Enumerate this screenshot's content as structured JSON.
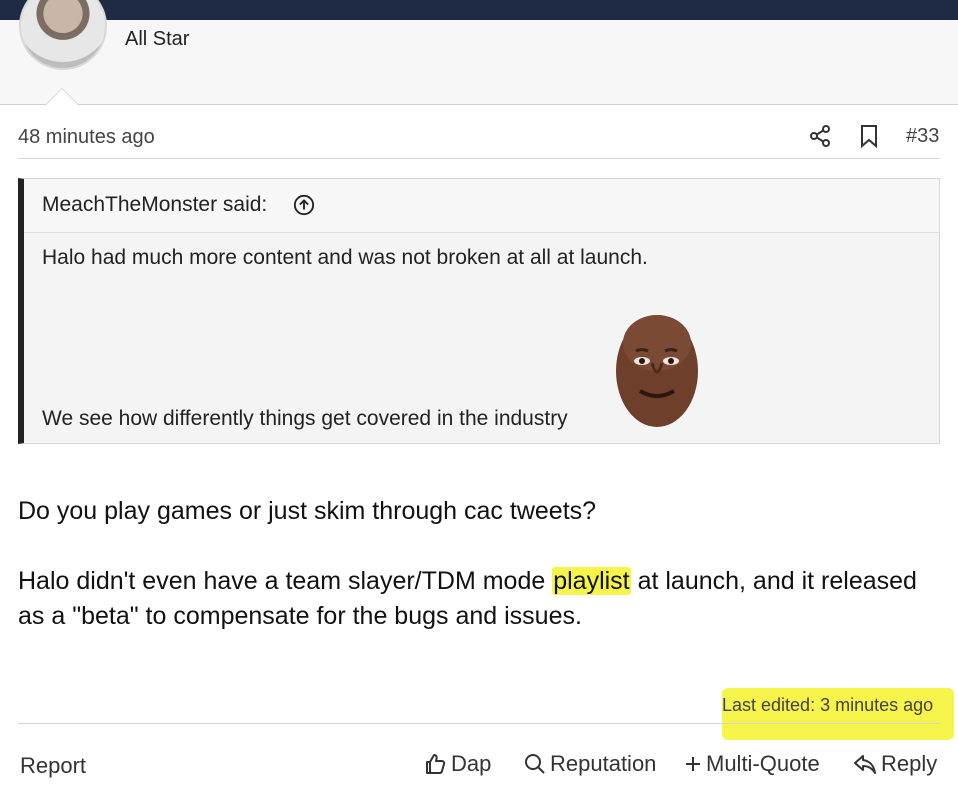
{
  "author": {
    "rank": "All Star"
  },
  "post_meta": {
    "timestamp": "48 minutes ago",
    "post_number": "#33",
    "icons": [
      "share-icon",
      "bookmark-icon"
    ]
  },
  "quote": {
    "author": "MeachTheMonster said:",
    "line1": "Halo had much more content and was not broken at all at launch.",
    "line2": "We see how differently things get covered in the industry"
  },
  "body": {
    "paragraph1": "Do you play games or just skim through cac tweets?",
    "paragraph2_before": "Halo didn't even have a team slayer/TDM mode ",
    "paragraph2_highlight": "playlist",
    "paragraph2_after": " at launch, and it released as a \"beta\" to compensate for the bugs and issues."
  },
  "footer": {
    "last_edited": "Last edited: 3 minutes ago",
    "report": "Report",
    "dap": "Dap",
    "reputation": "Reputation",
    "multi_quote": "Multi-Quote",
    "reply": "Reply"
  },
  "colors": {
    "top_bar": "#1f2a44",
    "highlight": "#f6f34a",
    "quote_border": "#222222"
  }
}
